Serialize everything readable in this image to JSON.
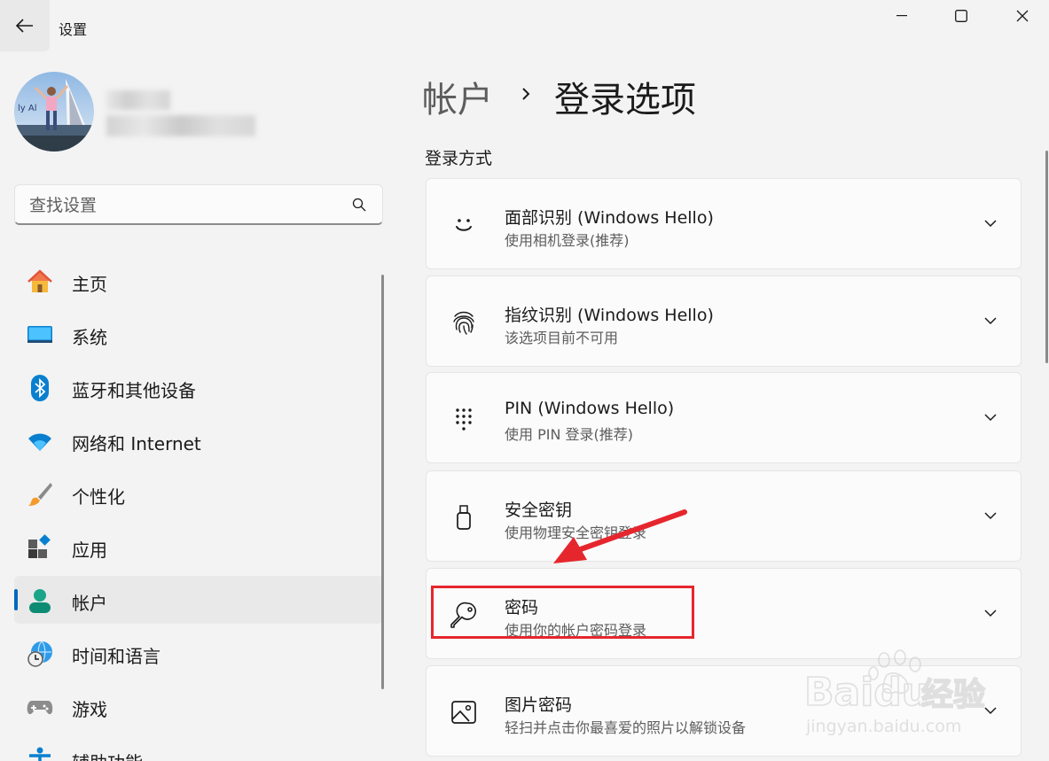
{
  "window": {
    "title": "设置"
  },
  "search": {
    "placeholder": "查找设置"
  },
  "nav": {
    "items": [
      {
        "label": "主页",
        "icon": "home-icon"
      },
      {
        "label": "系统",
        "icon": "system-icon"
      },
      {
        "label": "蓝牙和其他设备",
        "icon": "bluetooth-icon"
      },
      {
        "label": "网络和 Internet",
        "icon": "wifi-icon"
      },
      {
        "label": "个性化",
        "icon": "brush-icon"
      },
      {
        "label": "应用",
        "icon": "apps-icon"
      },
      {
        "label": "帐户",
        "icon": "account-icon",
        "selected": true
      },
      {
        "label": "时间和语言",
        "icon": "globe-clock-icon"
      },
      {
        "label": "游戏",
        "icon": "gamepad-icon"
      },
      {
        "label": "辅助功能",
        "icon": "accessibility-icon"
      }
    ]
  },
  "header": {
    "parent": "帐户",
    "current": "登录选项"
  },
  "section": {
    "title": "登录方式"
  },
  "options": [
    {
      "title": "面部识别 (Windows Hello)",
      "subtitle": "使用相机登录(推荐)",
      "icon": "face-icon"
    },
    {
      "title": "指纹识别 (Windows Hello)",
      "subtitle": "该选项目前不可用",
      "icon": "fingerprint-icon"
    },
    {
      "title": "PIN (Windows Hello)",
      "subtitle": "使用 PIN 登录(推荐)",
      "icon": "pin-keypad-icon"
    },
    {
      "title": "安全密钥",
      "subtitle": "使用物理安全密钥登录",
      "icon": "usb-key-icon"
    },
    {
      "title": "密码",
      "subtitle": "使用你的帐户密码登录",
      "icon": "key-icon"
    },
    {
      "title": "图片密码",
      "subtitle": "轻扫并点击你最喜爱的照片以解锁设备",
      "icon": "picture-icon"
    }
  ],
  "colors": {
    "accent": "#0067c0",
    "highlight": "#e6262d",
    "background": "#f3f3f3"
  },
  "watermark": {
    "brand": "Baidu",
    "suffix": "经验",
    "url": "jingyan.baidu.com"
  }
}
